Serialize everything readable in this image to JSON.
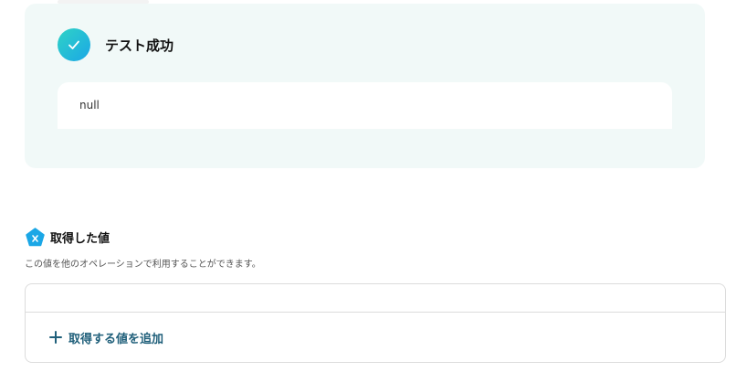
{
  "test_result": {
    "status_title": "テスト成功",
    "output_value": "null",
    "icon": "check-icon",
    "accent_gradient": [
      "#2fd3c6",
      "#1ba7e6"
    ],
    "card_background": "#f1f9f8"
  },
  "acquired_values": {
    "title": "取得した値",
    "description": "この値を他のオペレーションで利用することができます。",
    "icon": "variable-x-icon",
    "icon_color": "#1ba7e6",
    "add_button_label": "取得する値を追加",
    "add_button_color": "#1f5f7a"
  }
}
